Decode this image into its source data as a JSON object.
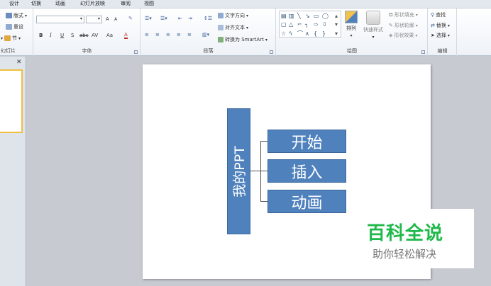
{
  "tabs": [
    "设计",
    "切换",
    "动画",
    "幻灯片放映",
    "审阅",
    "视图"
  ],
  "slides_group": {
    "label": "幻灯片",
    "layout_label": "版式",
    "reset_label": "重设",
    "section_label": "节"
  },
  "font_group": {
    "label": "字体",
    "bold": "B",
    "italic": "I",
    "underline": "U",
    "strike": "S",
    "shadow": "abc",
    "spacing": "AV",
    "case": "Aa",
    "grow": "A",
    "shrink": "A",
    "color": "A"
  },
  "paragraph_group": {
    "label": "段落",
    "text_direction_label": "文字方向",
    "align_text_label": "对齐文本",
    "smartart_label": "转换为 SmartArt"
  },
  "drawing_group": {
    "label": "绘图",
    "arrange_label": "排列",
    "quick_styles_label": "快速样式",
    "shape_fill_label": "形状填充",
    "shape_outline_label": "形状轮廓",
    "shape_effects_label": "形状效果"
  },
  "editing_group": {
    "label": "编辑",
    "find_label": "查找",
    "replace_label": "替换",
    "select_label": "选择"
  },
  "pane": {
    "close_glyph": "✕"
  },
  "slide": {
    "root_text": "我的PPT",
    "children": [
      "开始",
      "插入",
      "动画"
    ]
  },
  "watermark": {
    "title": "百科全说",
    "subtitle": "助你轻松解决"
  },
  "colors": {
    "accent": "#4f81bd",
    "watermark_green": "#1fb84a"
  }
}
